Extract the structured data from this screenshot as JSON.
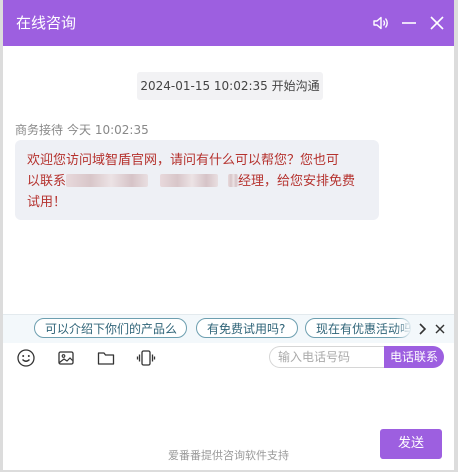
{
  "header": {
    "title": "在线咨询",
    "accent_color": "#9d5fe0",
    "icons": [
      "speaker-icon",
      "minimize-icon",
      "close-icon"
    ]
  },
  "chat": {
    "session_start": "2024-01-15 10:02:35 开始沟通",
    "message": {
      "sender": "商务接待",
      "time": "今天 10:02:35",
      "line1": "欢迎您访问域智盾官网，请问有什么可以帮您？您也可",
      "line2_start": "以联系",
      "line2_end": "经理，给您安排免费",
      "line3": "试用！"
    }
  },
  "quick_questions": {
    "items": [
      "可以介绍下你们的产品么",
      "有免费试用吗?",
      "现在有优惠活动吗"
    ],
    "icons": [
      "chevron-right-icon",
      "close-icon"
    ]
  },
  "toolbar": {
    "icons": [
      "emoji-icon",
      "image-icon",
      "folder-icon",
      "vibrate-icon"
    ],
    "phone_placeholder": "输入电话号码",
    "phone_button": "电话联系"
  },
  "composer": {
    "send_label": "发送",
    "footer_text": "爱番番提供咨询软件支持"
  }
}
